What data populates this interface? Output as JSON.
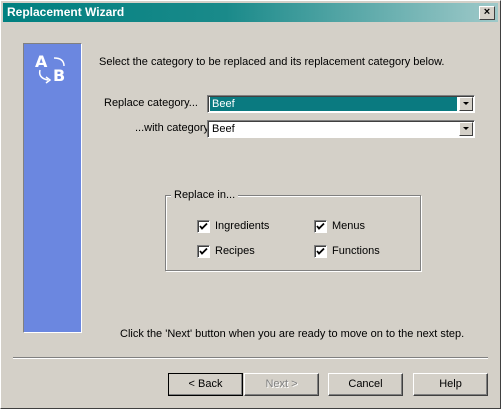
{
  "window": {
    "title": "Replacement Wizard",
    "close_glyph": "×",
    "title_color": "#008080",
    "panel_color": "#6b87e0"
  },
  "side_panel": {
    "icon": "a-to-b-replace-icon",
    "letter_a": "A",
    "letter_b": "B"
  },
  "instruction": "Select the category to be replaced and its replacement category below.",
  "replace_category": {
    "label": "Replace category...",
    "value": "Beef"
  },
  "with_category": {
    "label": "...with category",
    "value": "Beef"
  },
  "replace_in": {
    "legend": "Replace in...",
    "ingredients": {
      "label": "Ingredients",
      "checked": true
    },
    "menus": {
      "label": "Menus",
      "checked": true
    },
    "recipes": {
      "label": "Recipes",
      "checked": true
    },
    "functions": {
      "label": "Functions",
      "checked": true
    }
  },
  "footer_instruction": "Click the 'Next' button when you are ready to move on to the next step.",
  "buttons": {
    "back": "< Back",
    "next": "Next >",
    "cancel": "Cancel",
    "help": "Help"
  }
}
